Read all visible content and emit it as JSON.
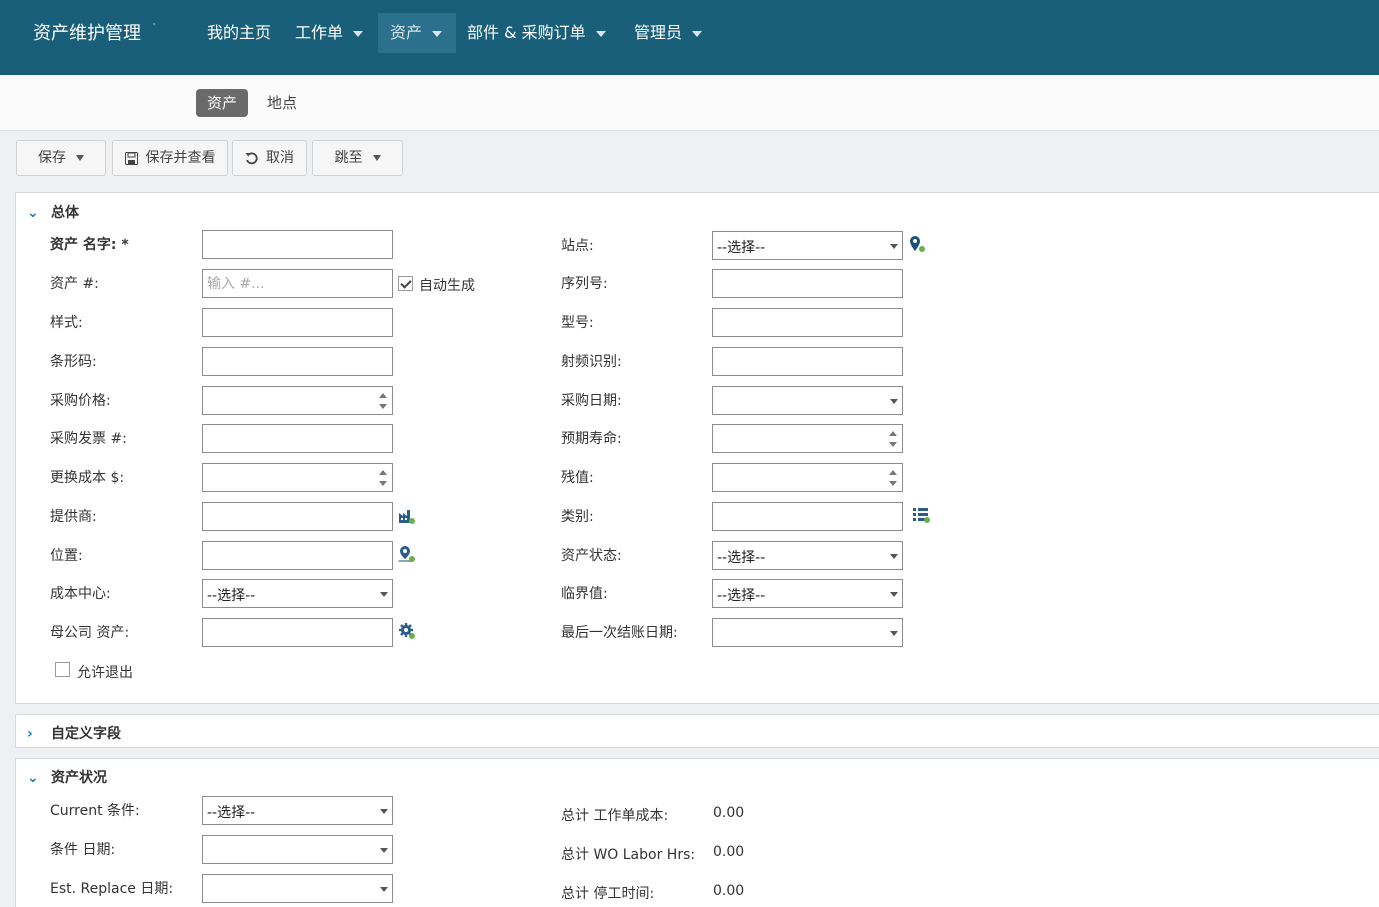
{
  "app": {
    "title": "资产维护管理",
    "title_mark": "'"
  },
  "nav": [
    {
      "label": "我的主页",
      "has_menu": false
    },
    {
      "label": "工作单",
      "has_menu": true
    },
    {
      "label": "资产",
      "has_menu": true,
      "active": true
    },
    {
      "label": "部件 & 采购订单",
      "has_menu": true
    },
    {
      "label": "管理员",
      "has_menu": true
    }
  ],
  "subnav": [
    {
      "label": "资产",
      "active": true
    },
    {
      "label": "地点",
      "active": false
    }
  ],
  "toolbar": {
    "save": "保存",
    "save_view": "保存并查看",
    "cancel": "取消",
    "goto": "跳至"
  },
  "general": {
    "title": "总体",
    "asset_name": {
      "label": "资产 名字: *",
      "value": ""
    },
    "asset_no": {
      "label": "资产 #:",
      "placeholder": "输入 #...",
      "auto_label": "自动生成",
      "auto_checked": true
    },
    "style": {
      "label": "样式:",
      "value": ""
    },
    "barcode": {
      "label": "条形码:",
      "value": ""
    },
    "purchase_price": {
      "label": "采购价格:",
      "value": ""
    },
    "purchase_invoice": {
      "label": "采购发票 #:",
      "value": ""
    },
    "replace_cost": {
      "label": "更换成本 $:",
      "value": ""
    },
    "supplier": {
      "label": "提供商:",
      "value": ""
    },
    "location": {
      "label": "位置:",
      "value": ""
    },
    "cost_center": {
      "label": "成本中心:",
      "value": "--选择--"
    },
    "parent_asset": {
      "label": "母公司 资产:",
      "value": ""
    },
    "allow_checkout": {
      "label": "允许退出",
      "checked": false
    },
    "site": {
      "label": "站点:",
      "value": "--选择--"
    },
    "serial": {
      "label": "序列号:",
      "value": ""
    },
    "model": {
      "label": "型号:",
      "value": ""
    },
    "rfid": {
      "label": "射频识别:",
      "value": ""
    },
    "purchase_date": {
      "label": "采购日期:",
      "value": ""
    },
    "expected_life": {
      "label": "预期寿命:",
      "value": ""
    },
    "residual": {
      "label": "残值:",
      "value": ""
    },
    "category": {
      "label": "类别:",
      "value": ""
    },
    "asset_status": {
      "label": "资产状态:",
      "value": "--选择--"
    },
    "criticality": {
      "label": "临界值:",
      "value": "--选择--"
    },
    "last_close_date": {
      "label": "最后一次结账日期:",
      "value": ""
    }
  },
  "custom": {
    "title": "自定义字段"
  },
  "condition": {
    "title": "资产状况",
    "current": {
      "label": "Current 条件:",
      "value": "--选择--"
    },
    "date": {
      "label": "条件 日期:",
      "value": ""
    },
    "est_replace": {
      "label": "Est. Replace 日期:",
      "value": ""
    },
    "wo_cost": {
      "label": "总计 工作单成本:",
      "value": "0.00"
    },
    "wo_labor": {
      "label": "总计 WO Labor Hrs:",
      "value": "0.00"
    },
    "downtime": {
      "label": "总计 停工时间:",
      "value": "0.00"
    }
  },
  "colors": {
    "header": "#1a5f7a",
    "header_active": "#2b718d",
    "accent": "#1a7ab0",
    "icon_green": "#6ab04c"
  }
}
